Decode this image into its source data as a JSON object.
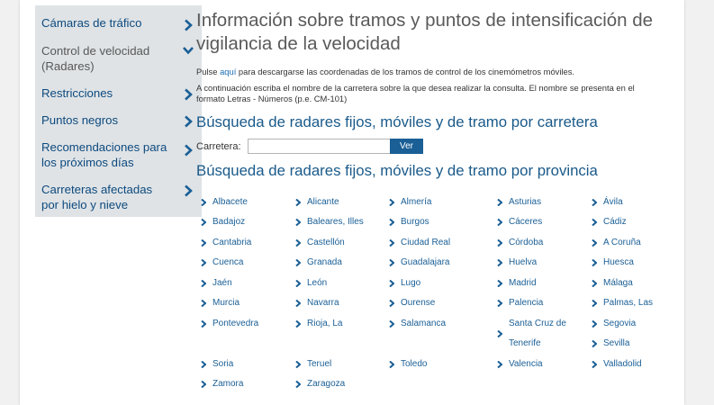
{
  "sidebar": {
    "items": [
      {
        "label": "Cámaras de tráfico",
        "arrow": "chevron-right-icon",
        "active": false
      },
      {
        "label": "Control de velocidad (Radares)",
        "arrow": "chevron-down-icon",
        "active": true
      },
      {
        "label": "Restricciones",
        "arrow": "chevron-right-icon",
        "active": false
      },
      {
        "label": "Puntos negros",
        "arrow": "chevron-right-icon",
        "active": false
      },
      {
        "label": "Recomendaciones para los próximos días",
        "arrow": "chevron-right-icon",
        "active": false
      },
      {
        "label": "Carreteras afectadas por hielo y nieve",
        "arrow": "chevron-right-icon",
        "active": false
      }
    ]
  },
  "main": {
    "title": "Información sobre tramos y puntos de intensificación de vigilancia de la velocidad",
    "download_prefix": "Pulse ",
    "download_link": "aquí",
    "download_suffix": " para descargarse las coordenadas de los tramos de control de los cinemómetros móviles.",
    "instructions": "A continuación escriba el nombre de la carretera sobre la que desea realizar la consulta. El nombre se presenta en el formato Letras - Números (p.e. CM-101)",
    "road_heading": "Búsqueda de radares fijos, móviles y de tramo por carretera",
    "road_label": "Carretera:",
    "road_value": "",
    "search_button": "Ver",
    "province_heading": "Búsqueda de radares fijos, móviles y de tramo por provincia"
  },
  "provinces": [
    "Albacete",
    "Alicante",
    "Almería",
    "Asturias",
    "Ávila",
    "Badajoz",
    "Baleares, Illes",
    "Burgos",
    "Cáceres",
    "Cádiz",
    "Cantabria",
    "Castellón",
    "Ciudad Real",
    "Córdoba",
    "A Coruña",
    "Cuenca",
    "Granada",
    "Guadalajara",
    "Huelva",
    "Huesca",
    "Jaén",
    "León",
    "Lugo",
    "Madrid",
    "Málaga",
    "Murcia",
    "Navarra",
    "Ourense",
    "Palencia",
    "Palmas, Las",
    "Pontevedra",
    "Rioja, La",
    "Salamanca",
    "Santa Cruz de Tenerife",
    "Segovia",
    "Sevilla",
    "Soria",
    "Teruel",
    "Toledo",
    "Valencia",
    "Valladolid",
    "Zamora",
    "Zaragoza"
  ],
  "colors": {
    "link": "#1a5f96",
    "heading": "#1a5a8a",
    "sidebar_bg": "#dfe3e6",
    "button_bg": "#1a5f96"
  }
}
